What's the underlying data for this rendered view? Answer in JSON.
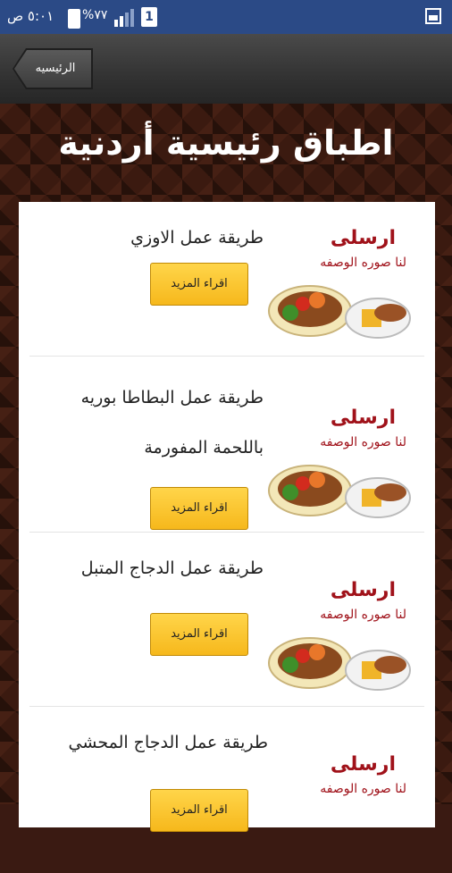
{
  "status_bar": {
    "time": "٥:٠١ ص",
    "battery": "%٧٧",
    "sim": "1"
  },
  "action_bar": {
    "back_label": "الرئيسيه"
  },
  "page": {
    "title": "اطباق رئيسية أردنية"
  },
  "promo": {
    "send": "ارسلى",
    "subtitle": "لنا صوره الوصفه"
  },
  "recipes": [
    {
      "title": "طريقة عمل الاوزي",
      "button": "اقراء المزيد"
    },
    {
      "title": "طريقة عمل البطاطا بوريه باللحمة المفورمة",
      "button": "اقراء المزيد"
    },
    {
      "title": "طريقة عمل الدجاج المتبل",
      "button": "اقراء المزيد"
    },
    {
      "title": "طريقة عمل الدجاج المحشي",
      "button": "اقراء المزيد"
    }
  ],
  "colors": {
    "status_bar": "#2b4a86",
    "button": "#f6b81c",
    "promo_text": "#a0121a"
  }
}
